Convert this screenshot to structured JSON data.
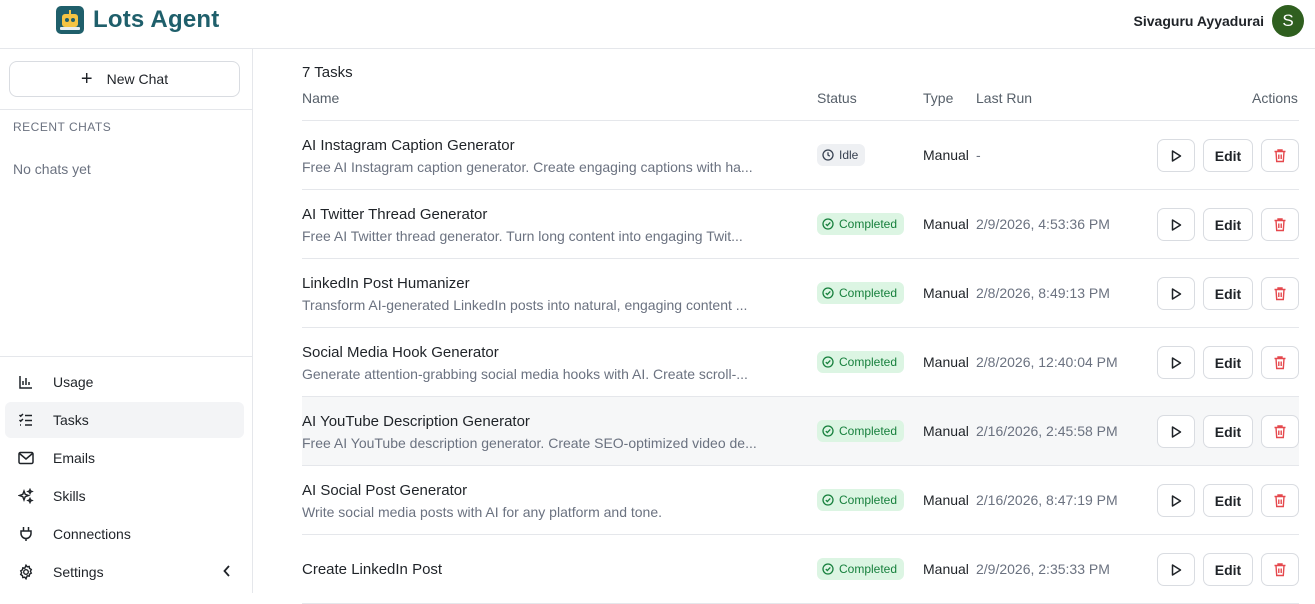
{
  "header": {
    "app_name": "Lots Agent",
    "user_name": "Sivaguru Ayyadurai",
    "avatar_initial": "S"
  },
  "sidebar": {
    "new_chat_label": "New Chat",
    "recent_chats_label": "RECENT CHATS",
    "empty_text": "No chats yet",
    "nav": [
      {
        "label": "Usage",
        "icon": "bar-chart-icon"
      },
      {
        "label": "Tasks",
        "icon": "task-list-icon",
        "active": true
      },
      {
        "label": "Emails",
        "icon": "mail-icon"
      },
      {
        "label": "Skills",
        "icon": "sparkles-icon"
      },
      {
        "label": "Connections",
        "icon": "plug-icon"
      },
      {
        "label": "Settings",
        "icon": "gear-icon"
      }
    ]
  },
  "tasks": {
    "count_label": "7 Tasks",
    "columns": {
      "name": "Name",
      "status": "Status",
      "type": "Type",
      "last_run": "Last Run",
      "actions": "Actions"
    },
    "edit_label": "Edit",
    "rows": [
      {
        "name": "AI Instagram Caption Generator",
        "desc": "Free AI Instagram caption generator. Create engaging captions with ha...",
        "status": "Idle",
        "type": "Manual",
        "last_run": "-"
      },
      {
        "name": "AI Twitter Thread Generator",
        "desc": "Free AI Twitter thread generator. Turn long content into engaging Twit...",
        "status": "Completed",
        "type": "Manual",
        "last_run": "2/9/2026, 4:53:36 PM"
      },
      {
        "name": "LinkedIn Post Humanizer",
        "desc": "Transform AI-generated LinkedIn posts into natural, engaging content ...",
        "status": "Completed",
        "type": "Manual",
        "last_run": "2/8/2026, 8:49:13 PM"
      },
      {
        "name": "Social Media Hook Generator",
        "desc": "Generate attention-grabbing social media hooks with AI. Create scroll-...",
        "status": "Completed",
        "type": "Manual",
        "last_run": "2/8/2026, 12:40:04 PM"
      },
      {
        "name": "AI YouTube Description Generator",
        "desc": "Free AI YouTube description generator. Create SEO-optimized video de...",
        "status": "Completed",
        "type": "Manual",
        "last_run": "2/16/2026, 2:45:58 PM"
      },
      {
        "name": "AI Social Post Generator",
        "desc": "Write social media posts with AI for any platform and tone.",
        "status": "Completed",
        "type": "Manual",
        "last_run": "2/16/2026, 8:47:19 PM"
      },
      {
        "name": "Create LinkedIn Post",
        "desc": "",
        "status": "Completed",
        "type": "Manual",
        "last_run": "2/9/2026, 2:35:33 PM"
      }
    ]
  },
  "colors": {
    "brand": "#1f5f6b",
    "completed_bg": "#dcf5e3",
    "completed_text": "#17803d",
    "delete_red": "#e5484d"
  }
}
